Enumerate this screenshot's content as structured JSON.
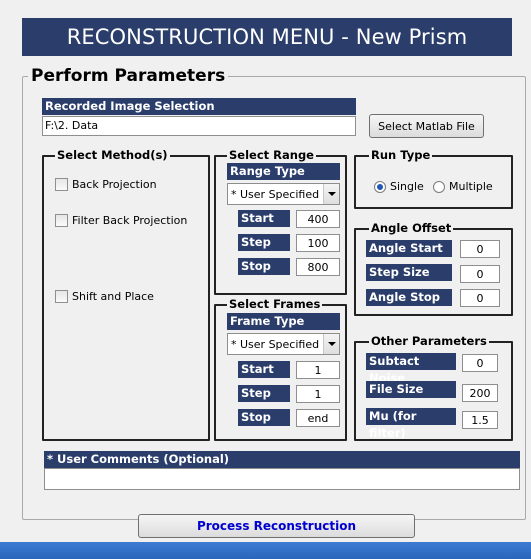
{
  "title": "RECONSTRUCTION MENU - New Prism",
  "perform_parameters": {
    "legend": "Perform Parameters",
    "recorded_image": {
      "label": "Recorded Image Selection",
      "path": "F:\\2. Data",
      "select_button": "Select Matlab File"
    },
    "select_method": {
      "legend": "Select Method(s)",
      "options": [
        "Back Projection",
        "Filter Back Projection",
        "Shift and Place"
      ]
    },
    "select_range": {
      "legend": "Select Range",
      "type_label": "Range Type",
      "type_value": "* User Specified",
      "start_label": "Start",
      "start_value": "400",
      "step_label": "Step",
      "step_value": "100",
      "stop_label": "Stop",
      "stop_value": "800"
    },
    "select_frames": {
      "legend": "Select Frames",
      "type_label": "Frame Type",
      "type_value": "* User Specified",
      "start_label": "Start",
      "start_value": "1",
      "step_label": "Step",
      "step_value": "1",
      "stop_label": "Stop",
      "stop_value": "end"
    },
    "run_type": {
      "legend": "Run Type",
      "options": [
        "Single",
        "Multiple"
      ],
      "selected": "Single"
    },
    "angle_offset": {
      "legend": "Angle Offset",
      "start_label": "Angle Start",
      "start_value": "0",
      "step_label": "Step Size",
      "step_value": "0",
      "stop_label": "Angle Stop",
      "stop_value": "0"
    },
    "other_parameters": {
      "legend": "Other Parameters",
      "noise_label": "Subtact Noise",
      "noise_value": "0",
      "size_label": "File Size",
      "size_value": "200",
      "mu_label": "Mu (for filter)",
      "mu_value": "1.5"
    },
    "comments": {
      "label": "* User Comments (Optional)",
      "value": ""
    }
  },
  "process_button": "Process Reconstruction",
  "colors": {
    "header_bg": "#2a3d6b",
    "window_bg": "#f0f0f0",
    "process_text": "#0000d0",
    "radio_selected": "#1f58b6"
  }
}
